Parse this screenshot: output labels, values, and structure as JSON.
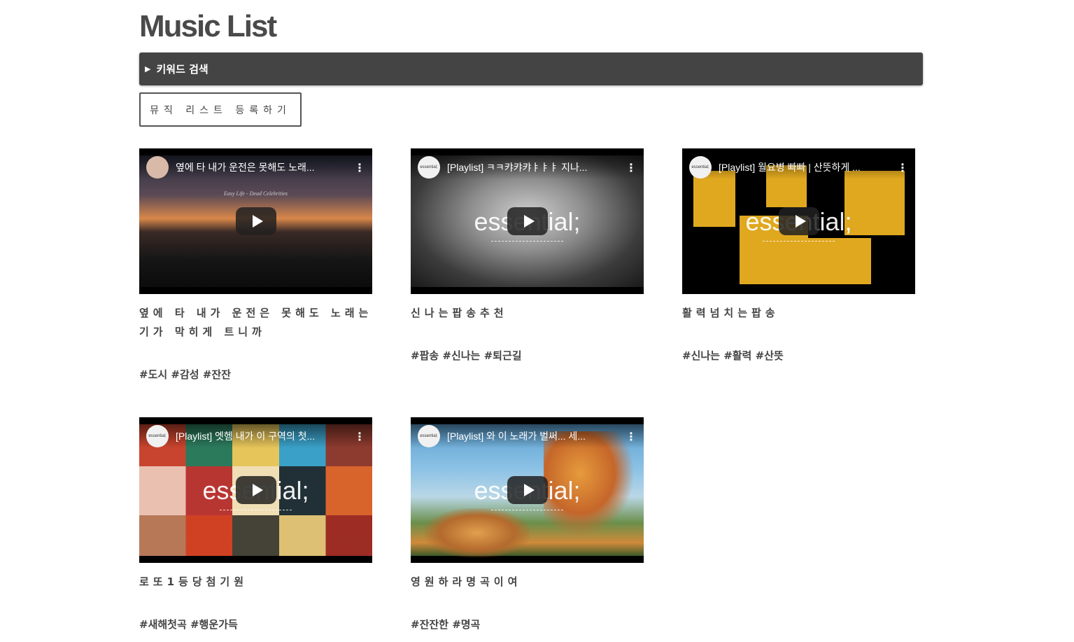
{
  "page": {
    "title": "Music List"
  },
  "search": {
    "toggle_icon": "▶",
    "label": "키워드 검색"
  },
  "register": {
    "label": "뮤직 리스트 등록하기"
  },
  "cards": [
    {
      "video_title": "옆에 타 내가 운전은 못해도 노래...",
      "channel": "",
      "overlay_text": "Easy Life - Dead Celebrities",
      "wordmark": "",
      "title": "옆에 타 내가 운전은 못해도 노래는 기가 막히게 트니까",
      "tags": "#도시 #감성 #잔잔"
    },
    {
      "video_title": "[Playlist] ㅋㅋ캬캬캬ㅑㅑㅑ 지나...",
      "channel": "essential;",
      "overlay_text": "",
      "wordmark": "essential;",
      "title": "신나는팝송추천",
      "tags": "#팝송 #신나는 #퇴근길"
    },
    {
      "video_title": "[Playlist] 월요병 빠빠 | 산뜻하게 ...",
      "channel": "essential;",
      "overlay_text": "",
      "wordmark": "essential;",
      "title": "활력넘치는팝송",
      "tags": "#신나는 #활력 #산뜻"
    },
    {
      "video_title": "[Playlist] 엣헴 내가 이 구역의 첫...",
      "channel": "essential;",
      "overlay_text": "",
      "wordmark": "essential;",
      "title": "로또1등당첨기원",
      "tags": "#새해첫곡 #행운가득"
    },
    {
      "video_title": "[Playlist] 와 이 노래가 벌써... 세...",
      "channel": "essential;",
      "overlay_text": "",
      "wordmark": "essential;",
      "title": "영원하라명곡이여",
      "tags": "#잔잔한 #명곡"
    }
  ],
  "colors": {
    "search_bar": "#444444",
    "text": "#444444",
    "thumb_bg": "#000000"
  },
  "icons": {
    "play": "play-icon",
    "more": "more-vert-icon",
    "toggle": "triangle-right-icon"
  }
}
